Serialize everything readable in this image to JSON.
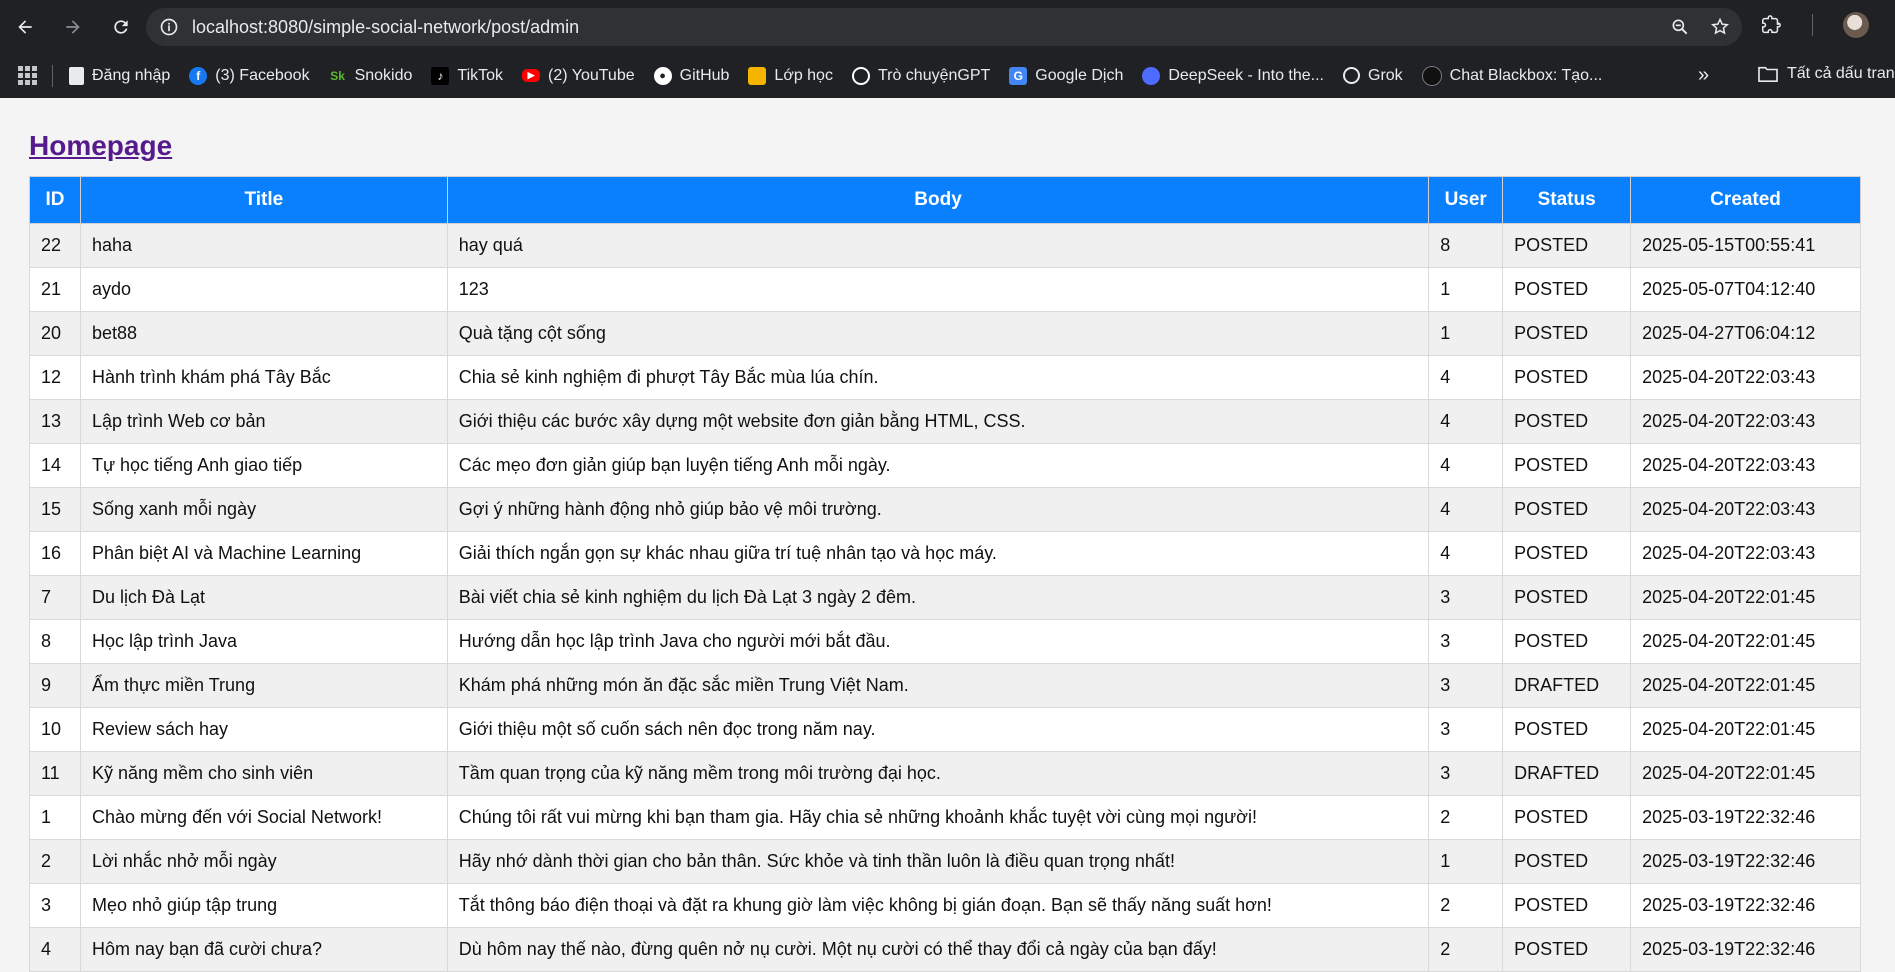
{
  "browser": {
    "url": "localhost:8080/simple-social-network/post/admin",
    "bookmarks": [
      {
        "label": "Đăng nhập",
        "icon": "page-icon",
        "color": "#e8eaed"
      },
      {
        "label": "(3) Facebook",
        "icon": "facebook-icon",
        "color": "#1877f2"
      },
      {
        "label": "Snokido",
        "icon": "snokido-icon",
        "color": "#5cb82e"
      },
      {
        "label": "TikTok",
        "icon": "tiktok-icon",
        "color": "#000000"
      },
      {
        "label": "(2) YouTube",
        "icon": "youtube-icon",
        "color": "#ff0000"
      },
      {
        "label": "GitHub",
        "icon": "github-icon",
        "color": "#ffffff"
      },
      {
        "label": "Lớp học",
        "icon": "classroom-icon",
        "color": "#f4b400"
      },
      {
        "label": "Trò chuyệnGPT",
        "icon": "openai-icon",
        "color": "#ffffff"
      },
      {
        "label": "Google Dịch",
        "icon": "google-translate-icon",
        "color": "#4285f4"
      },
      {
        "label": "DeepSeek - Into the...",
        "icon": "deepseek-icon",
        "color": "#4d6bfe"
      },
      {
        "label": "Grok",
        "icon": "grok-icon",
        "color": "#ffffff"
      },
      {
        "label": "Chat Blackbox: Tạo...",
        "icon": "blackbox-icon",
        "color": "#111111"
      }
    ],
    "more_label": "»",
    "folder_label": "Tất cả dấu trang"
  },
  "page": {
    "home_link": "Homepage",
    "columns": [
      "ID",
      "Title",
      "Body",
      "User",
      "Status",
      "Created"
    ],
    "rows": [
      {
        "id": "22",
        "title": "haha",
        "body": "hay quá",
        "user": "8",
        "status": "POSTED",
        "created": "2025-05-15T00:55:41"
      },
      {
        "id": "21",
        "title": "aydo",
        "body": "123",
        "user": "1",
        "status": "POSTED",
        "created": "2025-05-07T04:12:40"
      },
      {
        "id": "20",
        "title": "bet88",
        "body": "Quà tặng cột sống",
        "user": "1",
        "status": "POSTED",
        "created": "2025-04-27T06:04:12"
      },
      {
        "id": "12",
        "title": "Hành trình khám phá Tây Bắc",
        "body": "Chia sẻ kinh nghiệm đi phượt Tây Bắc mùa lúa chín.",
        "user": "4",
        "status": "POSTED",
        "created": "2025-04-20T22:03:43"
      },
      {
        "id": "13",
        "title": "Lập trình Web cơ bản",
        "body": "Giới thiệu các bước xây dựng một website đơn giản bằng HTML, CSS.",
        "user": "4",
        "status": "POSTED",
        "created": "2025-04-20T22:03:43"
      },
      {
        "id": "14",
        "title": "Tự học tiếng Anh giao tiếp",
        "body": "Các mẹo đơn giản giúp bạn luyện tiếng Anh mỗi ngày.",
        "user": "4",
        "status": "POSTED",
        "created": "2025-04-20T22:03:43"
      },
      {
        "id": "15",
        "title": "Sống xanh mỗi ngày",
        "body": "Gợi ý những hành động nhỏ giúp bảo vệ môi trường.",
        "user": "4",
        "status": "POSTED",
        "created": "2025-04-20T22:03:43"
      },
      {
        "id": "16",
        "title": "Phân biệt AI và Machine Learning",
        "body": "Giải thích ngắn gọn sự khác nhau giữa trí tuệ nhân tạo và học máy.",
        "user": "4",
        "status": "POSTED",
        "created": "2025-04-20T22:03:43"
      },
      {
        "id": "7",
        "title": "Du lịch Đà Lạt",
        "body": "Bài viết chia sẻ kinh nghiệm du lịch Đà Lạt 3 ngày 2 đêm.",
        "user": "3",
        "status": "POSTED",
        "created": "2025-04-20T22:01:45"
      },
      {
        "id": "8",
        "title": "Học lập trình Java",
        "body": "Hướng dẫn học lập trình Java cho người mới bắt đầu.",
        "user": "3",
        "status": "POSTED",
        "created": "2025-04-20T22:01:45"
      },
      {
        "id": "9",
        "title": "Ẩm thực miền Trung",
        "body": "Khám phá những món ăn đặc sắc miền Trung Việt Nam.",
        "user": "3",
        "status": "DRAFTED",
        "created": "2025-04-20T22:01:45"
      },
      {
        "id": "10",
        "title": "Review sách hay",
        "body": "Giới thiệu một số cuốn sách nên đọc trong năm nay.",
        "user": "3",
        "status": "POSTED",
        "created": "2025-04-20T22:01:45"
      },
      {
        "id": "11",
        "title": "Kỹ năng mềm cho sinh viên",
        "body": "Tầm quan trọng của kỹ năng mềm trong môi trường đại học.",
        "user": "3",
        "status": "DRAFTED",
        "created": "2025-04-20T22:01:45"
      },
      {
        "id": "1",
        "title": "Chào mừng đến với Social Network!",
        "body": "Chúng tôi rất vui mừng khi bạn tham gia. Hãy chia sẻ những khoảnh khắc tuyệt vời cùng mọi người!",
        "user": "2",
        "status": "POSTED",
        "created": "2025-03-19T22:32:46"
      },
      {
        "id": "2",
        "title": "Lời nhắc nhở mỗi ngày",
        "body": "Hãy nhớ dành thời gian cho bản thân. Sức khỏe và tinh thần luôn là điều quan trọng nhất!",
        "user": "1",
        "status": "POSTED",
        "created": "2025-03-19T22:32:46"
      },
      {
        "id": "3",
        "title": "Mẹo nhỏ giúp tập trung",
        "body": "Tắt thông báo điện thoại và đặt ra khung giờ làm việc không bị gián đoạn. Bạn sẽ thấy năng suất hơn!",
        "user": "2",
        "status": "POSTED",
        "created": "2025-03-19T22:32:46"
      },
      {
        "id": "4",
        "title": "Hôm nay bạn đã cười chưa?",
        "body": "Dù hôm nay thế nào, đừng quên nở nụ cười. Một nụ cười có thể thay đổi cả ngày của bạn đấy!",
        "user": "2",
        "status": "POSTED",
        "created": "2025-03-19T22:32:46"
      }
    ]
  }
}
